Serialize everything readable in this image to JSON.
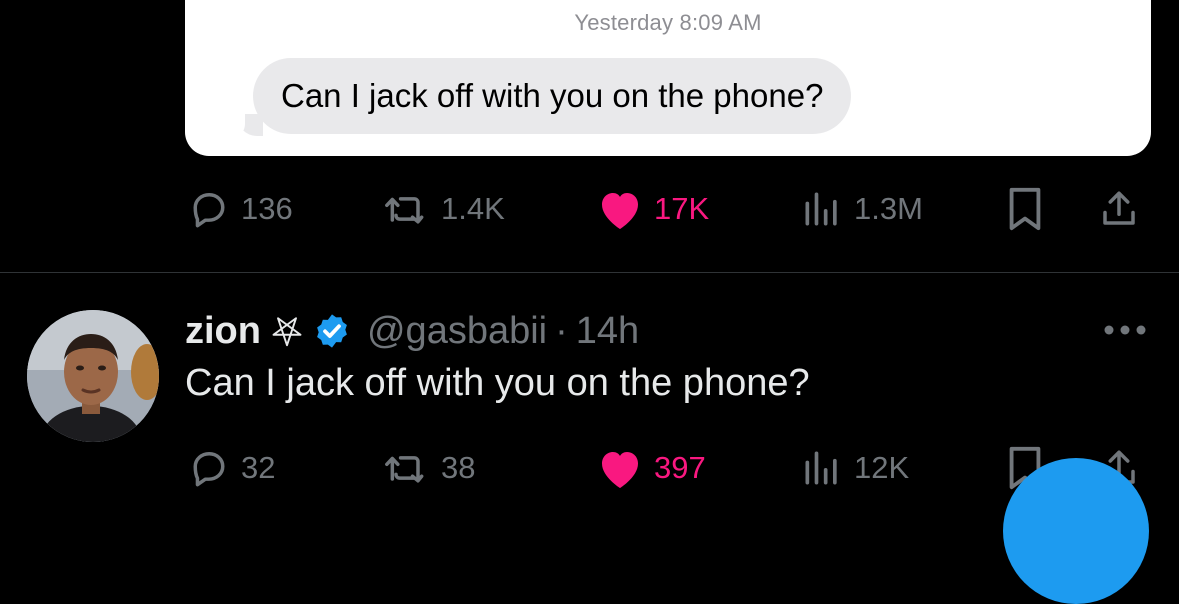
{
  "embedded_screenshot": {
    "timestamp_day": "Yesterday",
    "timestamp_time": "8:09 AM",
    "message": "Can I jack off with you on the phone?"
  },
  "tweet1_actions": {
    "replies": "136",
    "reposts": "1.4K",
    "likes": "17K",
    "views": "1.3M"
  },
  "tweet2": {
    "name": "zion",
    "handle": "@gasbabii",
    "separator": "·",
    "time": "14h",
    "text": "Can I jack off with you on the phone?",
    "actions": {
      "replies": "32",
      "reposts": "38",
      "likes": "397",
      "views": "12K"
    }
  },
  "colors": {
    "background": "#000000",
    "text": "#e7e9ea",
    "muted": "#71767b",
    "like": "#f91880",
    "verified": "#1d9bf0",
    "fab": "#1d9bf0"
  },
  "icons": [
    "reply-icon",
    "repost-icon",
    "like-icon",
    "views-icon",
    "bookmark-icon",
    "share-icon",
    "pentagram-icon",
    "verified-badge-icon",
    "more-icon"
  ]
}
